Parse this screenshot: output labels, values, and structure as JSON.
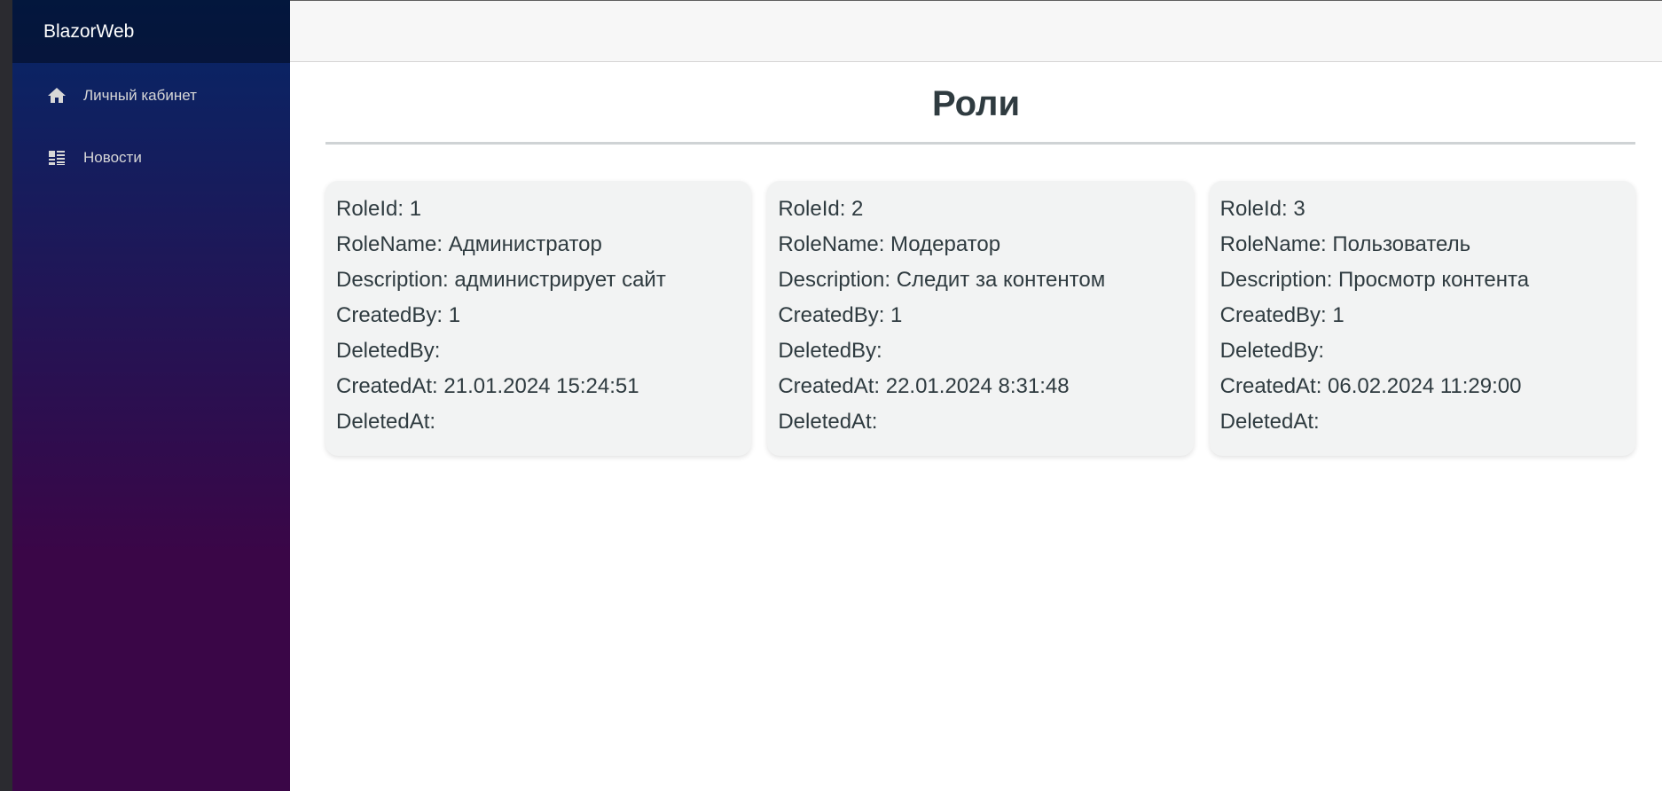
{
  "sidebar": {
    "brand": "BlazorWeb",
    "items": [
      {
        "label": "Личный кабинет",
        "icon": "home-icon"
      },
      {
        "label": "Новости",
        "icon": "list-icon"
      }
    ]
  },
  "main": {
    "title": "Роли",
    "roles": [
      {
        "role_id": "RoleId: 1",
        "role_name": "RoleName: Администратор",
        "description": "Description: администрирует сайт",
        "created_by": "CreatedBy: 1",
        "deleted_by": "DeletedBy:",
        "created_at": "CreatedAt: 21.01.2024 15:24:51",
        "deleted_at": "DeletedAt:"
      },
      {
        "role_id": "RoleId: 2",
        "role_name": "RoleName: Модератор",
        "description": "Description: Следит за контентом",
        "created_by": "CreatedBy: 1",
        "deleted_by": "DeletedBy:",
        "created_at": "CreatedAt: 22.01.2024 8:31:48",
        "deleted_at": "DeletedAt:"
      },
      {
        "role_id": "RoleId: 3",
        "role_name": "RoleName: Пользователь",
        "description": "Description: Просмотр контента",
        "created_by": "CreatedBy: 1",
        "deleted_by": "DeletedBy:",
        "created_at": "CreatedAt: 06.02.2024 11:29:00",
        "deleted_at": "DeletedAt:"
      }
    ]
  },
  "colors": {
    "sidebar_top": "#052767",
    "sidebar_bottom": "#3a0647",
    "card_bg": "#f2f3f3",
    "text": "#2f3b40"
  }
}
